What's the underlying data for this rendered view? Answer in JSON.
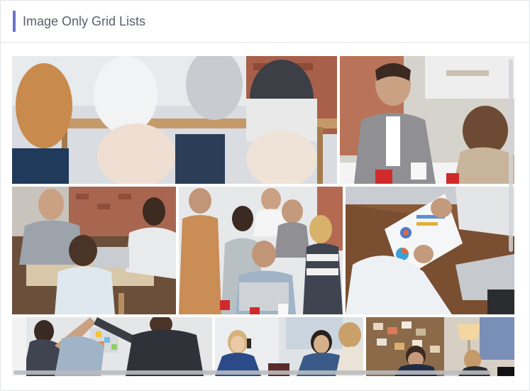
{
  "card": {
    "title": "Image Only Grid Lists",
    "accent_color": "#6a73c9"
  },
  "grid": {
    "tiles": [
      {
        "name": "team-meeting-table-image"
      },
      {
        "name": "smiling-businessman-image"
      },
      {
        "name": "office-discussion-image"
      },
      {
        "name": "team-group-selfie-image"
      },
      {
        "name": "charts-analysis-image"
      },
      {
        "name": "high-five-colleagues-image"
      },
      {
        "name": "phone-call-woman-image"
      },
      {
        "name": "office-laptop-man-image"
      }
    ]
  }
}
